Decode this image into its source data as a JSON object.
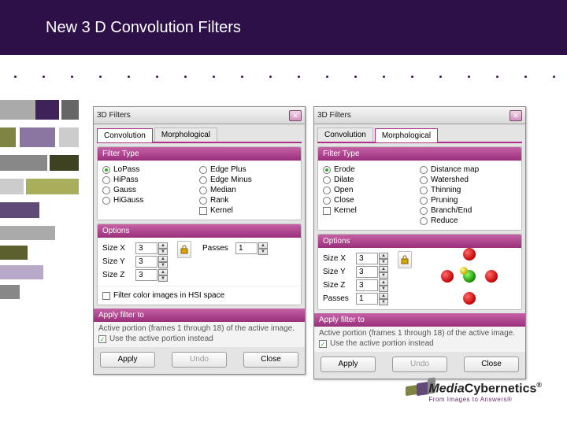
{
  "slide": {
    "title": "New 3 D Convolution Filters"
  },
  "dialogA": {
    "title": "3D Filters",
    "tabs": {
      "convolution": "Convolution",
      "morphological": "Morphological",
      "active": "convolution"
    },
    "filterTypeHead": "Filter Type",
    "filterTypes": {
      "col1": [
        "LoPass",
        "HiPass",
        "Gauss",
        "HiGauss"
      ],
      "col2": [
        "Edge Plus",
        "Edge Minus",
        "Median",
        "Rank",
        "Kernel"
      ],
      "selected": "LoPass"
    },
    "optionsHead": "Options",
    "fields": {
      "sizeX": {
        "label": "Size X",
        "value": "3"
      },
      "sizeY": {
        "label": "Size Y",
        "value": "3"
      },
      "sizeZ": {
        "label": "Size Z",
        "value": "3"
      },
      "passes": {
        "label": "Passes",
        "value": "1"
      }
    },
    "hsiCheck": "Filter color images in HSI space",
    "hsiChecked": false,
    "applyHead": "Apply filter to",
    "applyText": "Active portion (frames 1 through 18) of the active image.",
    "useActiveCheck": "Use the active portion instead",
    "useActiveChecked": true,
    "buttons": {
      "apply": "Apply",
      "undo": "Undo",
      "close": "Close"
    }
  },
  "dialogB": {
    "title": "3D Filters",
    "tabs": {
      "convolution": "Convolution",
      "morphological": "Morphological",
      "active": "morphological"
    },
    "filterTypeHead": "Filter Type",
    "filterTypes": {
      "col1": [
        "Erode",
        "Dilate",
        "Open",
        "Close",
        "Kernel"
      ],
      "col2": [
        "Distance map",
        "Watershed",
        "Thinning",
        "Pruning",
        "Branch/End",
        "Reduce"
      ],
      "selected": "Erode"
    },
    "optionsHead": "Options",
    "fields": {
      "sizeX": {
        "label": "Size X",
        "value": "3"
      },
      "sizeY": {
        "label": "Size Y",
        "value": "3"
      },
      "sizeZ": {
        "label": "Size Z",
        "value": "3"
      },
      "passes": {
        "label": "Passes",
        "value": "1"
      }
    },
    "applyHead": "Apply filter to",
    "applyText": "Active portion (frames 1 through 18) of the active image.",
    "useActiveCheck": "Use the active portion instead",
    "useActiveChecked": true,
    "buttons": {
      "apply": "Apply",
      "undo": "Undo",
      "close": "Close"
    }
  },
  "logo": {
    "brand_media": "Media",
    "brand_cyber": "Cybernetics",
    "reg": "®",
    "tagline": "From Images to Answers®"
  }
}
